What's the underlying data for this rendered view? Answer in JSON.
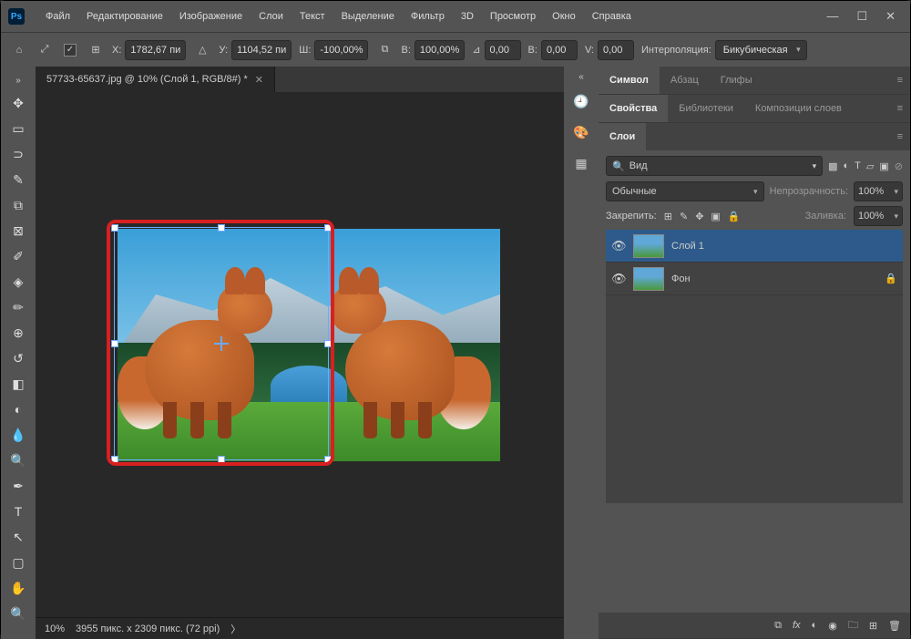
{
  "titlebar": {
    "logo": "Ps",
    "menus": [
      "Файл",
      "Редактирование",
      "Изображение",
      "Слои",
      "Текст",
      "Выделение",
      "Фильтр",
      "3D",
      "Просмотр",
      "Окно",
      "Справка"
    ]
  },
  "options": {
    "x_label": "X:",
    "x": "1782,67 пи",
    "y_label": "У:",
    "y": "1104,52 пи",
    "w_label": "Ш:",
    "w": "-100,00%",
    "h_label": "В:",
    "h": "100,00%",
    "angle_label": "⊿",
    "angle": "0,00",
    "hskew_label": "В:",
    "hskew": "0,00",
    "vskew_label": "V:",
    "vskew": "0,00",
    "interp_label": "Интерполяция:",
    "interp_value": "Бикубическая"
  },
  "doc": {
    "tab_title": "57733-65637.jpg @ 10% (Слой 1, RGB/8#) *",
    "zoom": "10%",
    "dims": "3955 пикс. x 2309 пикс. (72 ppi)"
  },
  "panels": {
    "char": {
      "tabs": [
        "Символ",
        "Абзац",
        "Глифы"
      ],
      "active": 0
    },
    "props": {
      "tabs": [
        "Свойства",
        "Библиотеки",
        "Композиции слоев"
      ],
      "active": 0
    },
    "layers": {
      "tabs": [
        "Слои"
      ],
      "active": 0,
      "search_label": "Вид",
      "blend": "Обычные",
      "opacity_label": "Непрозрачность:",
      "opacity": "100%",
      "lock_label": "Закрепить:",
      "fill_label": "Заливка:",
      "fill": "100%",
      "items": [
        {
          "name": "Слой 1",
          "locked": false,
          "active": true
        },
        {
          "name": "Фон",
          "locked": true,
          "active": false
        }
      ]
    }
  }
}
